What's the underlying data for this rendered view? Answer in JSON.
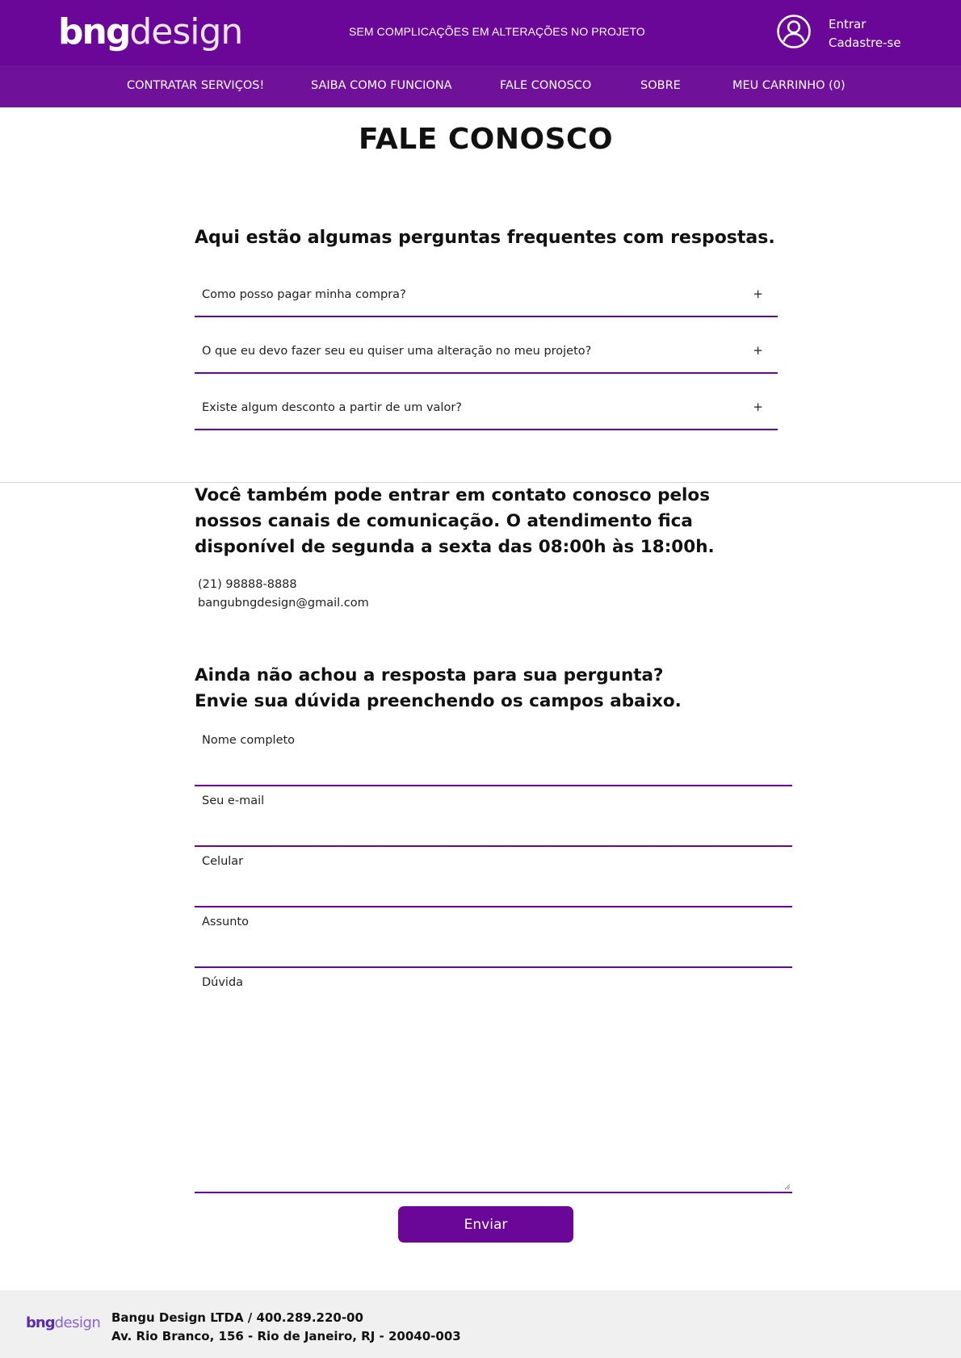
{
  "header": {
    "logo_bold": "bng",
    "logo_light": "design",
    "tagline": "SEM COMPLICAÇÕES EM ALTERAÇÕES NO PROJETO",
    "account": {
      "login": "Entrar",
      "signup": "Cadastre-se",
      "icon": "user-account-icon"
    }
  },
  "nav": {
    "items": [
      {
        "label": "CONTRATAR SERVIÇOS!"
      },
      {
        "label": "SAIBA COMO FUNCIONA"
      },
      {
        "label": "FALE CONOSCO"
      },
      {
        "label": "SOBRE"
      },
      {
        "label": "MEU CARRINHO (0)"
      }
    ]
  },
  "page": {
    "title": "FALE CONOSCO"
  },
  "faq": {
    "heading": "Aqui estão algumas perguntas frequentes com respostas.",
    "expand_symbol": "+",
    "items": [
      {
        "question": "Como posso pagar minha compra?"
      },
      {
        "question": "O que eu devo fazer seu eu quiser uma alteração no meu projeto?"
      },
      {
        "question": "Existe algum desconto a partir de um valor?"
      }
    ]
  },
  "contact": {
    "intro": "Você também pode entrar em contato conosco pelos nossos canais de comunicação. O atendimento fica disponível de segunda a sexta das 08:00h às 18:00h.",
    "phone": "(21) 98888-8888",
    "email": "bangubngdesign@gmail.com"
  },
  "form": {
    "heading_line1": "Ainda não achou a resposta para sua pergunta?",
    "heading_line2": "Envie sua dúvida preenchendo os campos abaixo.",
    "fields": {
      "name": {
        "label": "Nome completo",
        "value": ""
      },
      "email": {
        "label": "Seu e-mail",
        "value": ""
      },
      "phone": {
        "label": "Celular",
        "value": ""
      },
      "subject": {
        "label": "Assunto",
        "value": ""
      },
      "question": {
        "label": "Dúvida",
        "value": ""
      }
    },
    "submit_label": "Enviar"
  },
  "footer": {
    "logo_bold": "bng",
    "logo_light": "design",
    "company": "Bangu Design LTDA / 400.289.220-00",
    "address": "Av. Rio Branco, 156 - Rio de Janeiro, RJ - 20040-003"
  },
  "colors": {
    "brand_purple": "#6a0799",
    "nav_purple": "#6f1199",
    "footer_bg": "#f0f0f0"
  }
}
